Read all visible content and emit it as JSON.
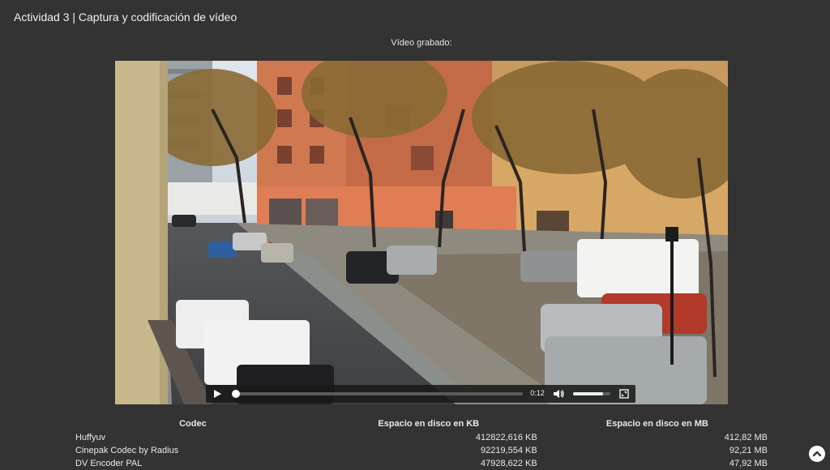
{
  "page": {
    "title": "Actividad 3 | Captura y codificación de vídeo",
    "video_caption": "Vídeo grabado:"
  },
  "video": {
    "time": "0:12",
    "progress": 0.01,
    "volume": 0.8,
    "icons": {
      "play": "play-icon",
      "volume": "volume-icon",
      "fullscreen": "fullscreen-icon"
    }
  },
  "table": {
    "headers": [
      "Codec",
      "Espacio en disco en KB",
      "Espacio en disco en MB"
    ],
    "rows": [
      [
        "Huffyuv",
        "412822,616 KB",
        "412,82 MB"
      ],
      [
        "Cinepak Codec by Radius",
        "92219,554 KB",
        "92,21 MB"
      ],
      [
        "DV Encoder PAL",
        "47928,622 KB",
        "47,92 MB"
      ]
    ]
  },
  "scroll_top": {
    "icon": "chevron-up-icon"
  }
}
